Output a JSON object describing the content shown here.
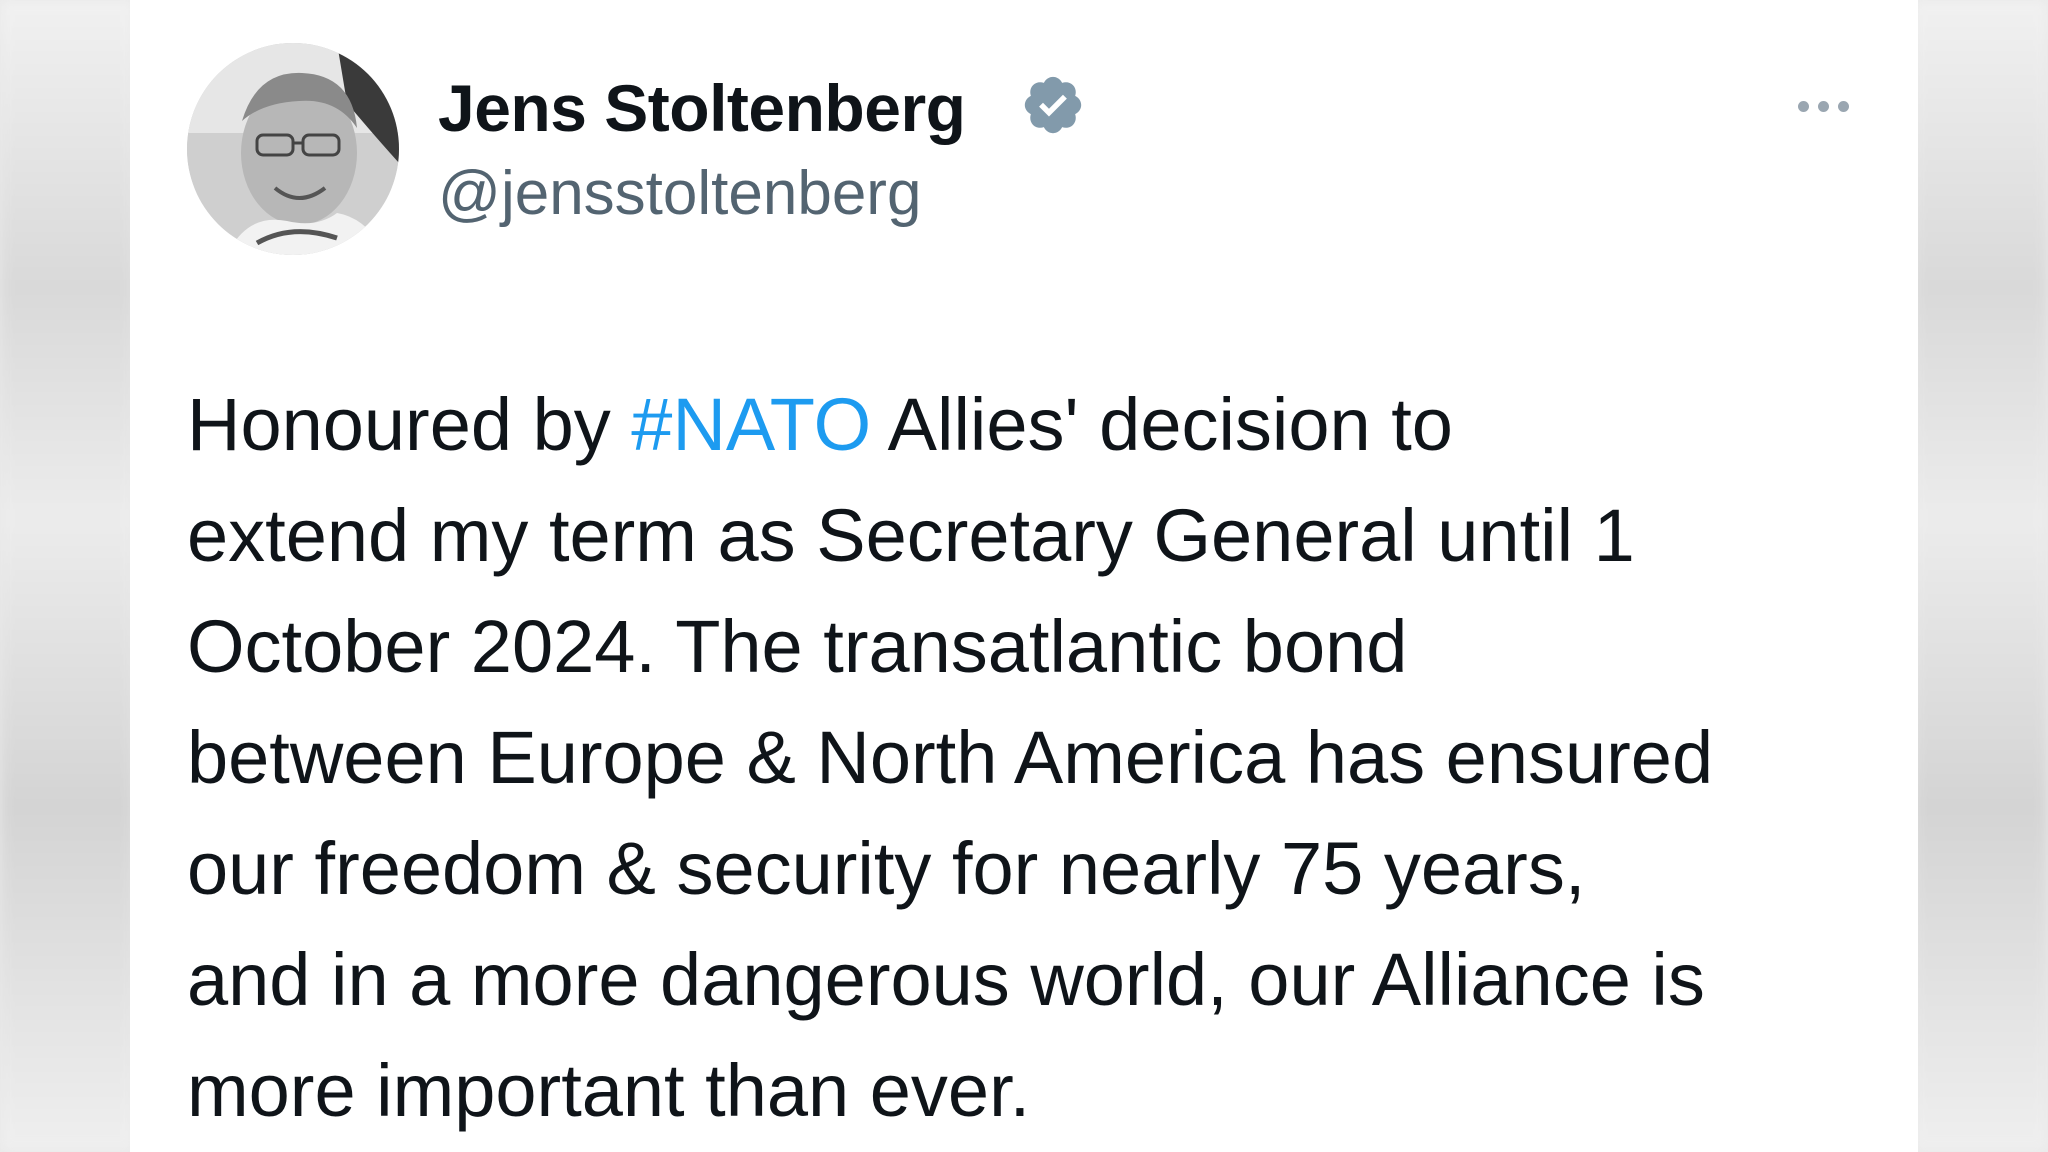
{
  "author": {
    "display_name": "Jens Stoltenberg",
    "handle": "@jensstoltenberg",
    "verified": true
  },
  "tweet": {
    "lines": [
      {
        "before": "Honoured by ",
        "hashtag": "#NATO",
        "after": " Allies' decision to"
      },
      {
        "text": "extend my term as Secretary General until 1"
      },
      {
        "text": "October 2024. The transatlantic bond"
      },
      {
        "text": "between Europe & North America has ensured"
      },
      {
        "text": "our freedom & security for nearly 75 years,"
      },
      {
        "text": "and in a more dangerous world, our Alliance is"
      },
      {
        "text": "more important than ever."
      }
    ]
  },
  "icons": {
    "verified": "verified-badge-icon",
    "more": "more-options-icon"
  },
  "colors": {
    "link": "#1d9bf0",
    "secondary_text": "#536471",
    "verified_badge": "#829aab",
    "primary_text": "#0f1419"
  }
}
